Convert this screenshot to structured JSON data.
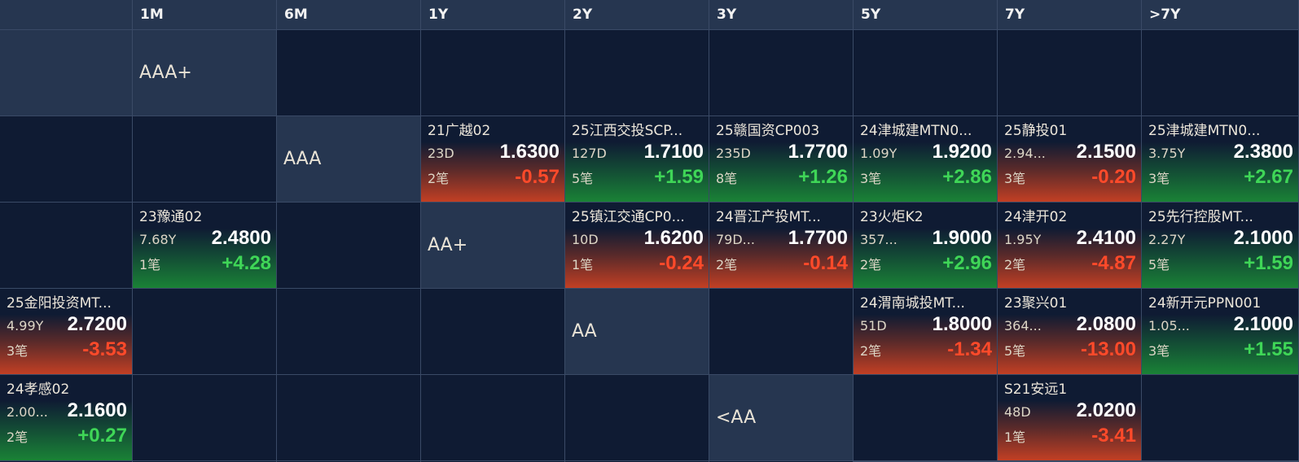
{
  "columns": [
    "1M",
    "6M",
    "1Y",
    "2Y",
    "3Y",
    "5Y",
    "7Y",
    ">7Y"
  ],
  "rows": [
    {
      "label": "AAA+",
      "cells": [
        null,
        null,
        null,
        null,
        null,
        null,
        null,
        null
      ]
    },
    {
      "label": "AAA",
      "cells": [
        {
          "name": "21广越02",
          "term": "23D",
          "yield": "1.6300",
          "count": "2笔",
          "change": "-0.57",
          "trend": "down"
        },
        {
          "name": "25江西交投SCP...",
          "term": "127D",
          "yield": "1.7100",
          "count": "5笔",
          "change": "+1.59",
          "trend": "up"
        },
        {
          "name": "25赣国资CP003",
          "term": "235D",
          "yield": "1.7700",
          "count": "8笔",
          "change": "+1.26",
          "trend": "up"
        },
        {
          "name": "24津城建MTN0...",
          "term": "1.09Y",
          "yield": "1.9200",
          "count": "3笔",
          "change": "+2.86",
          "trend": "up"
        },
        {
          "name": "25静投01",
          "term": "2.94...",
          "yield": "2.1500",
          "count": "3笔",
          "change": "-0.20",
          "trend": "down"
        },
        {
          "name": "25津城建MTN0...",
          "term": "3.75Y",
          "yield": "2.3800",
          "count": "3笔",
          "change": "+2.67",
          "trend": "up"
        },
        null,
        {
          "name": "23豫通02",
          "term": "7.68Y",
          "yield": "2.4800",
          "count": "1笔",
          "change": "+4.28",
          "trend": "up"
        }
      ]
    },
    {
      "label": "AA+",
      "cells": [
        {
          "name": "25镇江交通CP0...",
          "term": "10D",
          "yield": "1.6200",
          "count": "1笔",
          "change": "-0.24",
          "trend": "down"
        },
        {
          "name": "24晋江产投MT...",
          "term": "79D...",
          "yield": "1.7700",
          "count": "2笔",
          "change": "-0.14",
          "trend": "down"
        },
        {
          "name": "23火炬K2",
          "term": "357...",
          "yield": "1.9000",
          "count": "2笔",
          "change": "+2.96",
          "trend": "up"
        },
        {
          "name": "24津开02",
          "term": "1.95Y",
          "yield": "2.4100",
          "count": "2笔",
          "change": "-4.87",
          "trend": "down"
        },
        {
          "name": "25先行控股MT...",
          "term": "2.27Y",
          "yield": "2.1000",
          "count": "5笔",
          "change": "+1.59",
          "trend": "up"
        },
        {
          "name": "25金阳投资MT...",
          "term": "4.99Y",
          "yield": "2.7200",
          "count": "3笔",
          "change": "-3.53",
          "trend": "down"
        },
        null,
        null
      ]
    },
    {
      "label": "AA",
      "cells": [
        null,
        {
          "name": "24渭南城投MT...",
          "term": "51D",
          "yield": "1.8000",
          "count": "2笔",
          "change": "-1.34",
          "trend": "down"
        },
        {
          "name": "23聚兴01",
          "term": "364...",
          "yield": "2.0800",
          "count": "5笔",
          "change": "-13.00",
          "trend": "down"
        },
        {
          "name": "24新开元PPN001",
          "term": "1.05...",
          "yield": "2.1000",
          "count": "3笔",
          "change": "+1.55",
          "trend": "up"
        },
        {
          "name": "24孝感02",
          "term": "2.00...",
          "yield": "2.1600",
          "count": "2笔",
          "change": "+0.27",
          "trend": "up"
        },
        null,
        null,
        null
      ]
    },
    {
      "label": "<AA",
      "cells": [
        null,
        {
          "name": "S21安远1",
          "term": "48D",
          "yield": "2.0200",
          "count": "1笔",
          "change": "-3.41",
          "trend": "down"
        },
        null,
        null,
        null,
        null,
        null,
        null
      ]
    }
  ],
  "colors": {
    "up": "#3fd657",
    "down": "#ff4a2a",
    "header_bg": "#263650",
    "cell_bg": "#0f1b33"
  }
}
